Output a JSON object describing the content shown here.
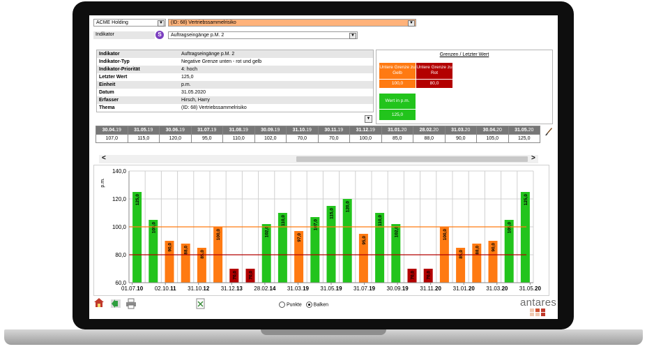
{
  "top": {
    "company": "ACME Holding",
    "thema": "(ID:  68) Vertriebssammelrisiko",
    "indikator_label": "Indikator",
    "s_badge": "S",
    "indikator_value": "Auftragseingänge p.M. 2"
  },
  "info": [
    {
      "k": "Indikator",
      "v": "Auftragseingänge p.M. 2"
    },
    {
      "k": "Indikator-Typ",
      "v": "Negative Grenze unten  - rot und gelb"
    },
    {
      "k": "Indikator-Priorität",
      "v": "4: hoch"
    },
    {
      "k": "Letzter Wert",
      "v": "125,0"
    },
    {
      "k": "Einheit",
      "v": "p.m."
    },
    {
      "k": "Datum",
      "v": "31.05.2020"
    },
    {
      "k": "Erfasser",
      "v": "Hirsch, Harry"
    },
    {
      "k": "Thema",
      "v": "(ID:  68) Vertriebssammelrisiko"
    }
  ],
  "limits": {
    "title": "Grenzen / Letzter Wert",
    "yellow_label": "Untere Grenze zu Gelb",
    "yellow_value": "100,0",
    "red_label": "Untere Grenze zu Rot",
    "red_value": "80,0",
    "value_label": "Wert in p.m.",
    "value_value": "125,0",
    "colors": {
      "orange": "#ff7a12",
      "red": "#b30000",
      "green": "#22c41c"
    }
  },
  "dates_row": {
    "headers": [
      {
        "a": "30.04.",
        "b": "19"
      },
      {
        "a": "31.05.",
        "b": "19"
      },
      {
        "a": "30.06.",
        "b": "19"
      },
      {
        "a": "31.07.",
        "b": "19"
      },
      {
        "a": "31.08.",
        "b": "19"
      },
      {
        "a": "30.09.",
        "b": "19"
      },
      {
        "a": "31.10.",
        "b": "19"
      },
      {
        "a": "30.11.",
        "b": "19"
      },
      {
        "a": "31.12.",
        "b": "19"
      },
      {
        "a": "31.01.",
        "b": "20"
      },
      {
        "a": "28.02.",
        "b": "20"
      },
      {
        "a": "31.03.",
        "b": "20"
      },
      {
        "a": "30.04.",
        "b": "20"
      },
      {
        "a": "31.05.",
        "b": "20"
      }
    ],
    "values": [
      "107,0",
      "115,0",
      "120,0",
      "95,0",
      "110,0",
      "102,0",
      "70,0",
      "70,0",
      "100,0",
      "85,0",
      "88,0",
      "90,0",
      "105,0",
      "125,0"
    ]
  },
  "scroll": {
    "left": "<",
    "right": ">"
  },
  "chart_data": {
    "type": "bar",
    "ylabel": "p.m.",
    "ylim": [
      60,
      140
    ],
    "yticks": [
      "60,0",
      "80,0",
      "100,0",
      "120,0",
      "140,0"
    ],
    "values": [
      125,
      105,
      90,
      88,
      85,
      100,
      70,
      70,
      102,
      110,
      97,
      107,
      115,
      120,
      95,
      110,
      102,
      70,
      70,
      100,
      85,
      88,
      90,
      105,
      125
    ],
    "value_labels": [
      "125,0",
      "105,0",
      "90,0",
      "88,0",
      "85,0",
      "100,0",
      "70,0",
      "70,0",
      "102,0",
      "110,0",
      "97,0",
      "107,0",
      "115,0",
      "120,0",
      "95,0",
      "110,0",
      "102,0",
      "70,0",
      "70,0",
      "100,0",
      "85,0",
      "88,0",
      "90,0",
      "105,0",
      "125,0"
    ],
    "xtick_labels": [
      {
        "a": "01.07.",
        "b": "10"
      },
      {
        "a": "02.10.",
        "b": "11"
      },
      {
        "a": "31.10.",
        "b": "12"
      },
      {
        "a": "31.12.",
        "b": "13"
      },
      {
        "a": "28.02.",
        "b": "14"
      },
      {
        "a": "31.03.",
        "b": "19"
      },
      {
        "a": "31.05.",
        "b": "19"
      },
      {
        "a": "31.07.",
        "b": "19"
      },
      {
        "a": "30.09.",
        "b": "19"
      },
      {
        "a": "31.11.",
        "b": "20"
      },
      {
        "a": "31.01.",
        "b": "20"
      },
      {
        "a": "31.03.",
        "b": "20"
      },
      {
        "a": "31.05.",
        "b": "20"
      }
    ],
    "thresholds": {
      "yellow": 100,
      "red": 80
    },
    "grid": true
  },
  "footer": {
    "radio_points": "Punkte",
    "radio_bars": "Balken",
    "brand": "antares"
  }
}
